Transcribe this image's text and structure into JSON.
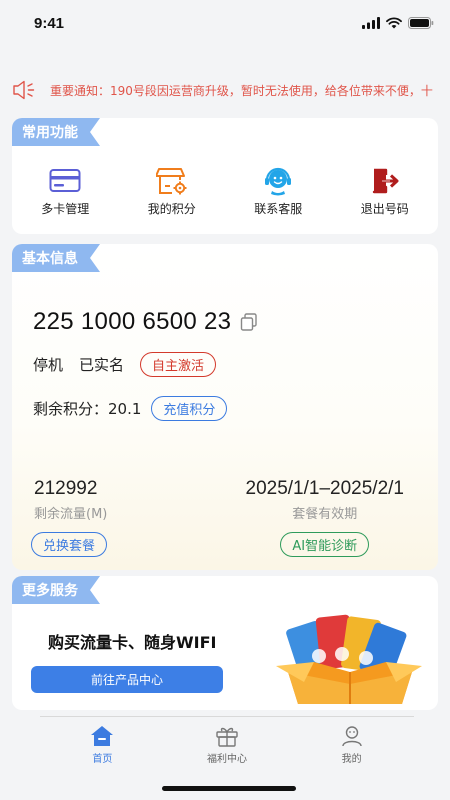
{
  "status_bar": {
    "time": "9:41"
  },
  "notice": {
    "text": "重要通知：190号段因运营商升级，暂时无法使用，给各位带来不便，十"
  },
  "common_functions": {
    "title": "常用功能",
    "items": [
      {
        "label": "多卡管理",
        "icon": "card-icon"
      },
      {
        "label": "我的积分",
        "icon": "shop-icon"
      },
      {
        "label": "联系客服",
        "icon": "headset-icon"
      },
      {
        "label": "退出号码",
        "icon": "exit-icon"
      }
    ]
  },
  "basic_info": {
    "title": "基本信息",
    "phone_number": "225 1000 6500 23",
    "line_status": "停机",
    "verification": "已实名",
    "activate_label": "自主激活",
    "points_label": "剩余积分：",
    "points_value": "20.1",
    "recharge_label": "充值积分",
    "data_remaining": "212992",
    "data_label": "剩余流量(M)",
    "exchange_label": "兑换套餐",
    "validity": "2025/1/1–2025/2/1",
    "validity_label": "套餐有效期",
    "diagnose_label": "AI智能诊断"
  },
  "more_services": {
    "title": "更多服务",
    "promo_title": "购买流量卡、随身WIFI",
    "button_label": "前往产品中心"
  },
  "tabbar": {
    "items": [
      {
        "label": "首页",
        "active": true
      },
      {
        "label": "福利中心",
        "active": false
      },
      {
        "label": "我的",
        "active": false
      }
    ]
  },
  "colors": {
    "accent_blue": "#3c7be0",
    "tag_blue": "#8fb8f0",
    "alert_red": "#d33a2c",
    "success_green": "#2f9b5b"
  }
}
